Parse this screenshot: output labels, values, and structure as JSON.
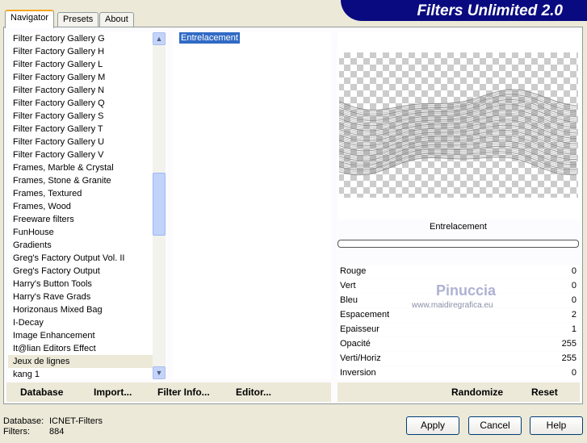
{
  "title": "Filters Unlimited 2.0",
  "tabs": [
    "Navigator",
    "Presets",
    "About"
  ],
  "categories": [
    "Filter Factory Gallery G",
    "Filter Factory Gallery H",
    "Filter Factory Gallery L",
    "Filter Factory Gallery M",
    "Filter Factory Gallery N",
    "Filter Factory Gallery Q",
    "Filter Factory Gallery S",
    "Filter Factory Gallery T",
    "Filter Factory Gallery U",
    "Filter Factory Gallery V",
    "Frames, Marble & Crystal",
    "Frames, Stone & Granite",
    "Frames, Textured",
    "Frames, Wood",
    "Freeware filters",
    "FunHouse",
    "Gradients",
    "Greg's Factory Output Vol. II",
    "Greg's Factory Output",
    "Harry's Button Tools",
    "Harry's Rave Grads",
    "Horizonaus Mixed Bag",
    "I-Decay",
    "Image Enhancement",
    "It@lian Editors Effect",
    "Jeux de lignes",
    "kang 1"
  ],
  "selected_category": "Jeux de lignes",
  "filters": [
    "Entrelacement"
  ],
  "filter_name": "Entrelacement",
  "params": [
    {
      "label": "Rouge",
      "value": "0"
    },
    {
      "label": "Vert",
      "value": "0"
    },
    {
      "label": "Bleu",
      "value": "0"
    },
    {
      "label": "Espacement",
      "value": "2"
    },
    {
      "label": "Epaisseur",
      "value": "1"
    },
    {
      "label": "Opacité",
      "value": "255"
    },
    {
      "label": "Verti/Horiz",
      "value": "255"
    },
    {
      "label": "Inversion",
      "value": "0"
    }
  ],
  "watermark": {
    "name": "Pinuccia",
    "url": "www.maidiregrafica.eu"
  },
  "toolbar": {
    "database": "Database",
    "import": "Import...",
    "filter_info": "Filter Info...",
    "editor": "Editor...",
    "randomize": "Randomize",
    "reset": "Reset"
  },
  "status": {
    "database_label": "Database:",
    "database_value": "ICNET-Filters",
    "filters_label": "Filters:",
    "filters_value": "884"
  },
  "buttons": {
    "apply": "Apply",
    "cancel": "Cancel",
    "help": "Help"
  },
  "progress": 0
}
